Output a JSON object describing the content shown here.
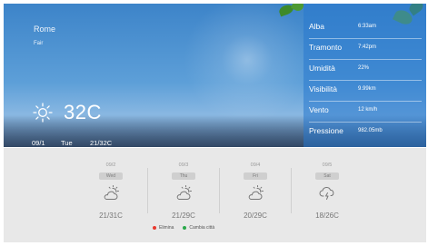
{
  "location": {
    "city": "Rome",
    "condition": "Fair"
  },
  "current": {
    "temperature": "32C",
    "icon": "sun-icon"
  },
  "date_line": {
    "date": "09/1",
    "weekday": "Tue",
    "range": "21/32C"
  },
  "details": [
    {
      "label": "Alba",
      "value": "6:33am"
    },
    {
      "label": "Tramonto",
      "value": "7:42pm"
    },
    {
      "label": "Umidità",
      "value": "22%"
    },
    {
      "label": "Visibilità",
      "value": "9.99km"
    },
    {
      "label": "Vento",
      "value": "12 km/h"
    },
    {
      "label": "Pressione",
      "value": "982.05mb"
    }
  ],
  "forecast": [
    {
      "date": "09/2",
      "day": "Wed",
      "icon": "partly-cloudy-icon",
      "range": "21/31C"
    },
    {
      "date": "09/3",
      "day": "Thu",
      "icon": "partly-cloudy-icon",
      "range": "21/29C"
    },
    {
      "date": "09/4",
      "day": "Fri",
      "icon": "partly-cloudy-icon",
      "range": "20/29C"
    },
    {
      "date": "09/5",
      "day": "Sat",
      "icon": "thunderstorm-icon",
      "range": "18/26C"
    }
  ],
  "legend": [
    {
      "label": "Elimina",
      "color": "#e8392e"
    },
    {
      "label": "Cambia città",
      "color": "#2aa84a"
    }
  ],
  "colors": {
    "panel": "#2878cd",
    "sky": "#5d9fd8",
    "footer": "#e8e8e8"
  }
}
